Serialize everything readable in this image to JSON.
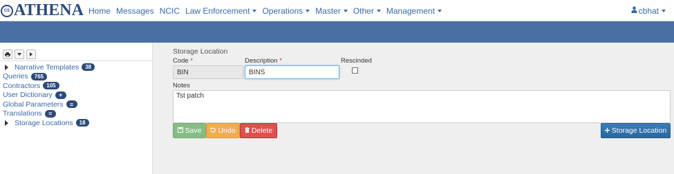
{
  "app": {
    "brand_badge": "CS",
    "brand_name": "ATHENA"
  },
  "nav": {
    "items": [
      {
        "label": "Home",
        "dropdown": false
      },
      {
        "label": "Messages",
        "dropdown": false
      },
      {
        "label": "NCIC",
        "dropdown": false
      },
      {
        "label": "Law Enforcement",
        "dropdown": true
      },
      {
        "label": "Operations",
        "dropdown": true
      },
      {
        "label": "Master",
        "dropdown": true
      },
      {
        "label": "Other",
        "dropdown": true
      },
      {
        "label": "Management",
        "dropdown": true
      }
    ],
    "user": "cbhat"
  },
  "sidebar": {
    "toolbar": [
      "print-icon",
      "caret-down-icon",
      "caret-right-icon"
    ],
    "items": [
      {
        "label": "Narrative Templates",
        "badge": "38",
        "expandable": true
      },
      {
        "label": "Queries",
        "badge": "765",
        "expandable": false
      },
      {
        "label": "Contractors",
        "badge": "105",
        "expandable": false
      },
      {
        "label": "User Dictionary",
        "badge_icon": "+",
        "expandable": false
      },
      {
        "label": "Global Parameters",
        "badge_icon": "≡",
        "expandable": false
      },
      {
        "label": "Translations",
        "badge_icon": "≡",
        "expandable": false
      },
      {
        "label": "Storage Locations",
        "badge": "18",
        "expandable": true
      }
    ]
  },
  "form": {
    "title": "Storage Location",
    "code_label": "Code",
    "code_value": "BIN",
    "description_label": "Description",
    "description_value": "BINS",
    "rescinded_label": "Rescinded",
    "rescinded_checked": false,
    "notes_label": "Notes",
    "notes_value": "Tst patch",
    "required_marker": "*"
  },
  "buttons": {
    "save": "Save",
    "undo": "Undo",
    "delete": "Delete",
    "add_storage_location": "Storage Location"
  },
  "colors": {
    "brand": "#2b4a7a",
    "band": "#4a6fa5",
    "link": "#3a69a7",
    "save": "#86bd86",
    "undo": "#f0ad4e",
    "delete": "#d9534f",
    "primary": "#2e6da4"
  }
}
